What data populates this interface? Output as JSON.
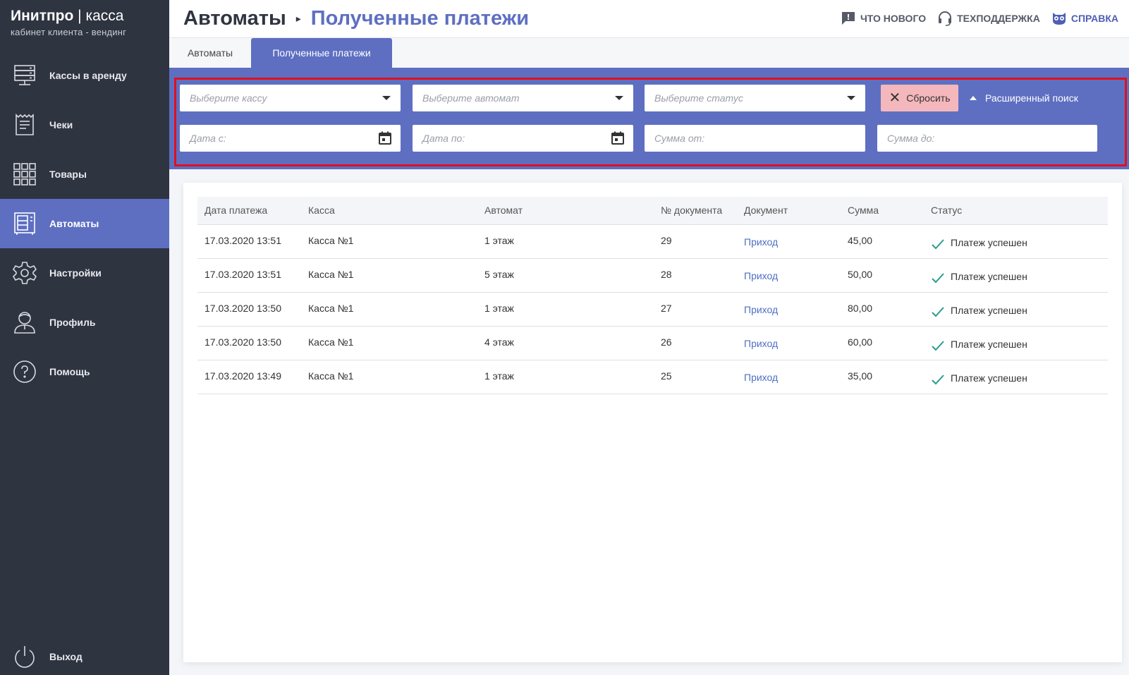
{
  "brand": {
    "name_bold": "Инитпро",
    "separator": "|",
    "name_thin": "касса",
    "subtitle": "кабинет клиента - вендинг"
  },
  "sidebar": {
    "items": [
      {
        "label": "Кассы в аренду",
        "icon": "server-icon",
        "active": false
      },
      {
        "label": "Чеки",
        "icon": "receipt-icon",
        "active": false
      },
      {
        "label": "Товары",
        "icon": "grid-icon",
        "active": false
      },
      {
        "label": "Автоматы",
        "icon": "vending-machine-icon",
        "active": true
      },
      {
        "label": "Настройки",
        "icon": "gear-icon",
        "active": false
      },
      {
        "label": "Профиль",
        "icon": "user-icon",
        "active": false
      },
      {
        "label": "Помощь",
        "icon": "help-icon",
        "active": false
      }
    ],
    "logout": {
      "label": "Выход",
      "icon": "power-icon"
    }
  },
  "header": {
    "crumb_1": "Автоматы",
    "crumb_sep": "▸",
    "crumb_2": "Полученные платежи",
    "links": {
      "news": "Что нового",
      "support": "Техподдержка",
      "help": "Справка"
    }
  },
  "tabs": [
    "Автоматы",
    "Полученные платежи"
  ],
  "filters": {
    "kassa_placeholder": "Выберите кассу",
    "automat_placeholder": "Выберите автомат",
    "status_placeholder": "Выберите статус",
    "reset_label": "Сбросить",
    "advanced_label": "Расширенный поиск",
    "date_from_placeholder": "Дата с:",
    "date_to_placeholder": "Дата по:",
    "sum_from_placeholder": "Сумма от:",
    "sum_to_placeholder": "Сумма до:"
  },
  "table": {
    "columns": [
      "Дата платежа",
      "Касса",
      "Автомат",
      "№ документа",
      "Документ",
      "Сумма",
      "Статус"
    ],
    "rows": [
      {
        "date": "17.03.2020 13:51",
        "kassa": "Касса №1",
        "automat": "1 этаж",
        "doc_no": "29",
        "doc": "Приход",
        "sum": "45,00",
        "status": "Платеж успешен"
      },
      {
        "date": "17.03.2020 13:51",
        "kassa": "Касса №1",
        "automat": "5 этаж",
        "doc_no": "28",
        "doc": "Приход",
        "sum": "50,00",
        "status": "Платеж успешен"
      },
      {
        "date": "17.03.2020 13:50",
        "kassa": "Касса №1",
        "automat": "1 этаж",
        "doc_no": "27",
        "doc": "Приход",
        "sum": "80,00",
        "status": "Платеж успешен"
      },
      {
        "date": "17.03.2020 13:50",
        "kassa": "Касса №1",
        "automat": "4 этаж",
        "doc_no": "26",
        "doc": "Приход",
        "sum": "60,00",
        "status": "Платеж успешен"
      },
      {
        "date": "17.03.2020 13:49",
        "kassa": "Касса №1",
        "automat": "1 этаж",
        "doc_no": "25",
        "doc": "Приход",
        "sum": "35,00",
        "status": "Платеж успешен"
      }
    ]
  },
  "colors": {
    "sidebar": "#2f3441",
    "accent": "#5e6fc2",
    "highlight": "#e0101c",
    "success": "#2a9d8f",
    "reset": "#f4b7bc"
  }
}
